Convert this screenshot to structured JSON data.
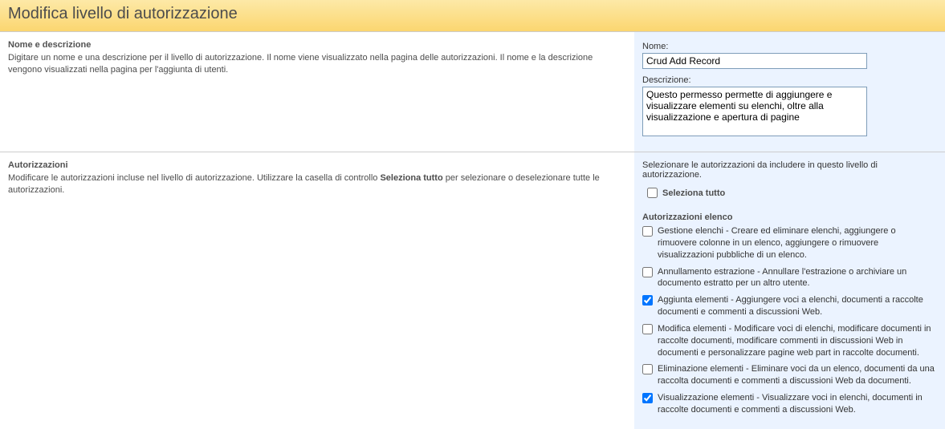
{
  "header": {
    "title": "Modifica livello di autorizzazione"
  },
  "nameSection": {
    "title": "Nome e descrizione",
    "desc": "Digitare un nome e una descrizione per il livello di autorizzazione. Il nome viene visualizzato nella pagina delle autorizzazioni. Il nome e la descrizione vengono visualizzati nella pagina per l'aggiunta di utenti.",
    "nameLabel": "Nome:",
    "nameValue": "Crud Add Record",
    "descLabel": "Descrizione:",
    "descValue": "Questo permesso permette di aggiungere e visualizzare elementi su elenchi, oltre alla visualizzazione e apertura di pagine "
  },
  "permSection": {
    "title": "Autorizzazioni",
    "descPrefix": "Modificare le autorizzazioni incluse nel livello di autorizzazione. Utilizzare la casella di controllo ",
    "descBold": "Seleziona tutto",
    "descSuffix": " per selezionare o deselezionare tutte le autorizzazioni.",
    "intro": "Selezionare le autorizzazioni da includere in questo livello di autorizzazione.",
    "selectAllLabel": "Seleziona tutto",
    "selectAllChecked": false,
    "groupTitle": "Autorizzazioni elenco",
    "items": [
      {
        "checked": false,
        "text": "Gestione elenchi  -  Creare ed eliminare elenchi, aggiungere o rimuovere colonne in un elenco, aggiungere o rimuovere visualizzazioni pubbliche di un elenco."
      },
      {
        "checked": false,
        "text": "Annullamento estrazione  -  Annullare l'estrazione o archiviare un documento estratto per un altro utente."
      },
      {
        "checked": true,
        "text": "Aggiunta elementi  -  Aggiungere voci a elenchi, documenti a raccolte documenti e commenti a discussioni Web."
      },
      {
        "checked": false,
        "text": "Modifica elementi  -  Modificare voci di elenchi, modificare documenti in raccolte documenti, modificare commenti in discussioni Web in documenti e personalizzare pagine web part in raccolte documenti."
      },
      {
        "checked": false,
        "text": "Eliminazione elementi  -  Eliminare voci da un elenco, documenti da una raccolta documenti e commenti a discussioni Web da documenti."
      },
      {
        "checked": true,
        "text": "Visualizzazione elementi  -  Visualizzare voci in elenchi, documenti in raccolte documenti e commenti a discussioni Web."
      }
    ]
  }
}
